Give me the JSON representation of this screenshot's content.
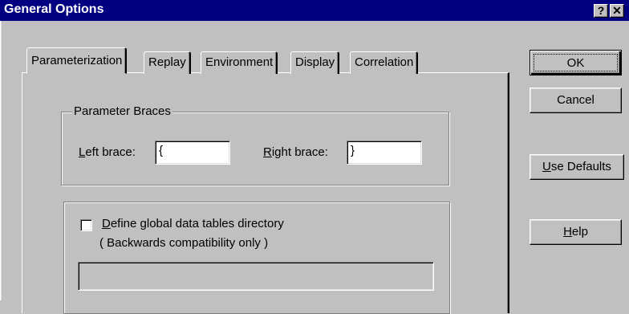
{
  "window": {
    "title": "General Options",
    "help_button": "?",
    "close_button": "✕"
  },
  "tabs": [
    {
      "label": "Parameterization",
      "active": true
    },
    {
      "label": "Replay",
      "active": false
    },
    {
      "label": "Environment",
      "active": false
    },
    {
      "label": "Display",
      "active": false
    },
    {
      "label": "Correlation",
      "active": false
    }
  ],
  "braces": {
    "group_label": "Parameter Braces",
    "left_mnemonic": "L",
    "left_label_rest": "eft brace:",
    "left_value": "{",
    "right_mnemonic": "R",
    "right_label_rest": "ight brace:",
    "right_value": "}"
  },
  "global_tables": {
    "checkbox_mnemonic": "D",
    "checkbox_label_rest": "efine global data tables directory",
    "checked": false,
    "note": "( Backwards compatibility only )",
    "directory_value": ""
  },
  "buttons": {
    "ok": "OK",
    "cancel": "Cancel",
    "use_defaults_mnemonic": "U",
    "use_defaults_rest": "se Defaults",
    "help_mnemonic": "H",
    "help_rest": "elp"
  }
}
